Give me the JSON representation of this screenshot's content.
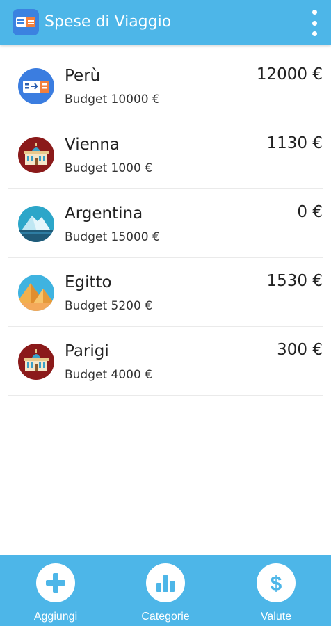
{
  "app": {
    "title": "Spese di Viaggio",
    "icon": "travel-ticket-icon",
    "menu_icon": "more-vert-icon"
  },
  "colors": {
    "primary": "#4db6e8",
    "text": "#222222",
    "divider": "#eaeaea"
  },
  "trips": [
    {
      "name": "Perù",
      "budget": "Budget 10000 €",
      "amount": "12000 €",
      "icon": "plane-ticket-icon"
    },
    {
      "name": "Vienna",
      "budget": "Budget 1000 €",
      "amount": "1130 €",
      "icon": "palace-icon"
    },
    {
      "name": "Argentina",
      "budget": "Budget 15000 €",
      "amount": "0 €",
      "icon": "glacier-icon"
    },
    {
      "name": "Egitto",
      "budget": "Budget 5200 €",
      "amount": "1530 €",
      "icon": "pyramids-icon"
    },
    {
      "name": "Parigi",
      "budget": "Budget 4000 €",
      "amount": "300 €",
      "icon": "palace-icon"
    }
  ],
  "bottom_nav": {
    "add_label": "Aggiungi",
    "categories_label": "Categorie",
    "currencies_label": "Valute"
  }
}
